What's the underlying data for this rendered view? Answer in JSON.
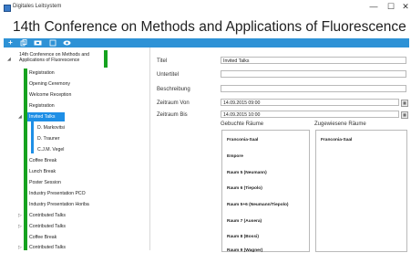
{
  "window": {
    "app_title": "Digitales Leitsystem",
    "controls": {
      "minimize": "—",
      "maximize": "☐",
      "close": "✕"
    }
  },
  "conference_title": "14th Conference on Methods and Applications of Fluorescence",
  "toolbar": {
    "icons": [
      "plus-icon",
      "copy-icon",
      "grid-icon",
      "edit-icon",
      "eye-icon"
    ]
  },
  "tree": {
    "root_label_line1": "14th Conference on Methods and",
    "root_label_line2": "Applications of Fluorescence",
    "items": [
      "Registration",
      "Opening Ceremony",
      "Welcome Reception",
      "Registration",
      "Invited Talks",
      "D. Markovitsi",
      "D. Trauner",
      "C.J.M. Vegel",
      "Coffee Break",
      "Lunch Break",
      "Poster Session",
      "Industry Presentation PCO",
      "Industry Presentation Horiba",
      "Contributed Talks",
      "Contributed Talks",
      "Coffee Break",
      "Contributed Talks"
    ],
    "selected_item": "Invited Talks",
    "colors": {
      "green": "#15a21f",
      "selected": "#1e8fe6"
    }
  },
  "form": {
    "labels": {
      "title": "Titel",
      "subtitle": "Untertitel",
      "description": "Beschreibung",
      "start": "Zeitraum Von",
      "end": "Zeitraum Bis"
    },
    "values": {
      "title": "Invited Talks",
      "subtitle": "",
      "description": "",
      "start": "14.09.2015 09:00",
      "end": "14.09.2015 10:00"
    },
    "booked_rooms_label": "Gebuchte Räume",
    "assigned_rooms_label": "Zugewiesene Räume",
    "booked_rooms": [
      "Franconia-Saal",
      "Empore",
      "Raum 5 (Neumann)",
      "Raum 6 (Tiepolo)",
      "Raum 5+6 (Neumann/Tiepolo)",
      "Raum 7 (Ausera)",
      "Raum 8 (Bossi)",
      "Raum 9 (Wagner)"
    ],
    "assigned_rooms": [
      "Franconia-Saal"
    ]
  }
}
